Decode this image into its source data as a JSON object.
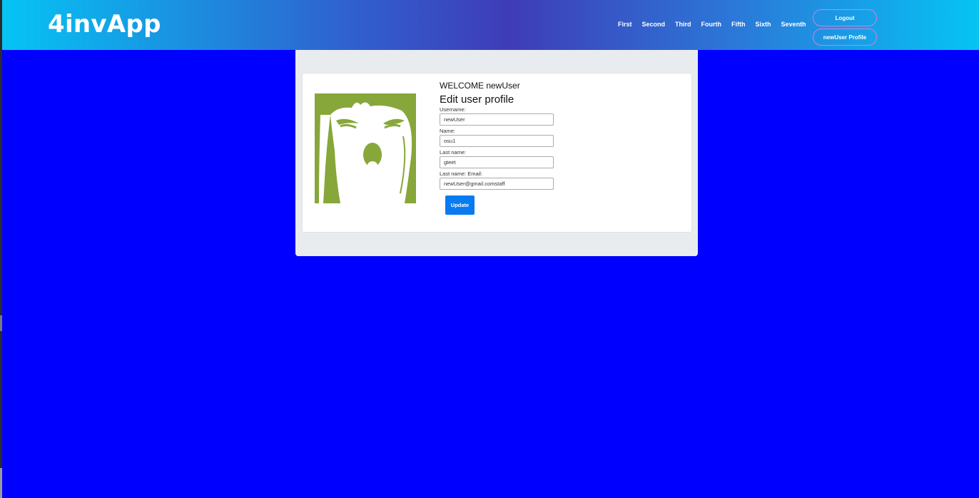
{
  "brand": "4invApp",
  "nav": {
    "links": [
      "First",
      "Second",
      "Third",
      "Fourth",
      "Fifth",
      "Sixth",
      "Seventh"
    ],
    "logout_label": "Logout",
    "profile_label": "newUser Profile"
  },
  "profile": {
    "welcome": "WELCOME newUser",
    "title": "Edit user profile",
    "fields": {
      "username_label": "Username:",
      "username_value": "newUser",
      "name_label": "Name:",
      "name_value": "osu1",
      "lastname_label": "Last name:",
      "lastname_value": "gteet",
      "email_label": "Last name: Email:",
      "email_value": "newUser@gmail.comstaff"
    },
    "update_label": "Update"
  },
  "colors": {
    "page_background": "#0000fe",
    "avatar_background": "#87a73a",
    "button": "#087bf0"
  }
}
